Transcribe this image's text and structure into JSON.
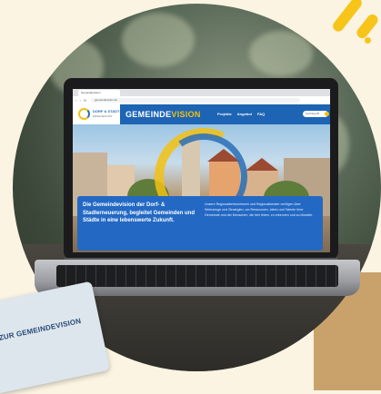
{
  "browser": {
    "tab_title": "Gemeindevision",
    "url": "gemeindevision.de",
    "nav_dots": "‹ › ⟳"
  },
  "site": {
    "logo_text": "DORF & STADT",
    "logo_subtext": "ERNEUERUNG",
    "brand_prefix": "GEMEINDE",
    "brand_suffix": "VISION",
    "nav": [
      "Projekte",
      "Angebot",
      "FAQ"
    ],
    "search_placeholder": "Suchbegriff"
  },
  "hero": {
    "headline": "Die Gemeindevision der Dorf- & Stadterneuerung, begleitet Gemeinden und Städte in eine lebenswerte Zukunft.",
    "body": "Unsere Regionalbetreuerinnen und Regionalberater verfügen über Werkzeuge und Strategien, um Ressourcen, Ideen und Talente Ihrer Gemeinde und der Menschen, die hier leben, zu erkennen und zu bündeln."
  },
  "card": {
    "text": "ZUR GEMEINDEVISION"
  },
  "colors": {
    "brand_blue": "#1d64b4",
    "brand_yellow": "#f2c113",
    "hero_box": "#2369c4",
    "background": "#fbf4e3"
  }
}
